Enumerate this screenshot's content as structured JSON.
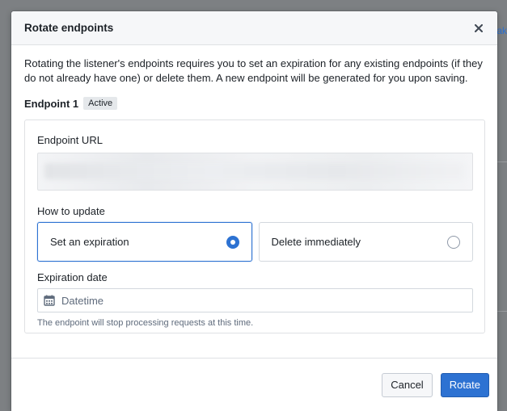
{
  "backdrop": {
    "link_fragment": "ak"
  },
  "dialog": {
    "title": "Rotate endpoints",
    "intro": "Rotating the listener's endpoints requires you to set an expiration for any existing endpoints (if they do not already have one) or delete them. A new endpoint will be generated for you upon saving.",
    "endpoint": {
      "title": "Endpoint 1",
      "status": "Active",
      "url_label": "Endpoint URL",
      "url_value": "",
      "how_label": "How to update",
      "options": [
        {
          "label": "Set an expiration",
          "selected": true
        },
        {
          "label": "Delete immediately",
          "selected": false
        }
      ],
      "expiration_label": "Expiration date",
      "date_placeholder": "Datetime",
      "helper_text": "The endpoint will stop processing requests at this time."
    },
    "footer": {
      "cancel_label": "Cancel",
      "rotate_label": "Rotate"
    }
  },
  "icons": {
    "close": "close-icon",
    "calendar": "calendar-icon"
  },
  "colors": {
    "primary": "#2d72d2",
    "backdrop": "#8a8d90"
  }
}
